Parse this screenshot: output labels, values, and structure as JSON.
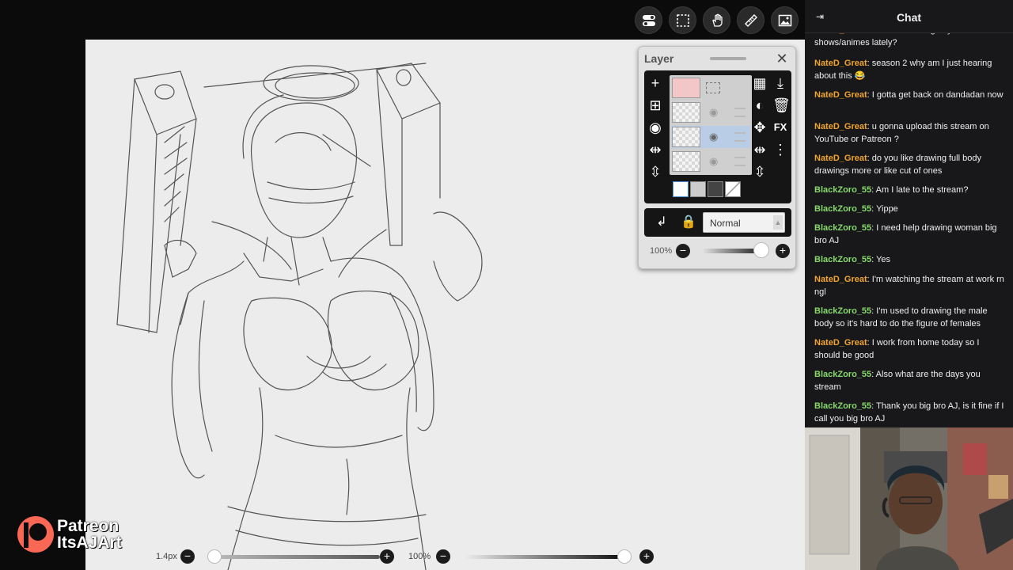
{
  "toolbar": {
    "icons": [
      "toggle-icon",
      "selection-icon",
      "hand-icon",
      "ruler-icon",
      "image-icon"
    ]
  },
  "layer_panel": {
    "title": "Layer",
    "close": "✕",
    "blend_mode": "Normal",
    "opacity_label": "100%"
  },
  "bottom_bar": {
    "brush_size": "1.4px",
    "brush_opacity": "100%"
  },
  "patreon": {
    "line1": "Patreon",
    "line2": "ItsAJArt"
  },
  "chat": {
    "title": "Chat",
    "messages": [
      {
        "user": "NateD_Great",
        "text": "u been watching any shows/animes lately?"
      },
      {
        "user": "NateD_Great",
        "text": "season 2 why am I just hearing about this 😂"
      },
      {
        "user": "NateD_Great",
        "text": "I gotta get back on dandadan now"
      },
      {
        "user": "NateD_Great",
        "text": "u gonna upload this stream on YouTube or Patreon ?"
      },
      {
        "user": "NateD_Great",
        "text": "do you like drawing full body drawings more or like cut of ones"
      },
      {
        "user": "BlackZoro_55",
        "text": "Am I late to the stream?"
      },
      {
        "user": "BlackZoro_55",
        "text": "Yippe"
      },
      {
        "user": "BlackZoro_55",
        "text": "I need help drawing woman big bro AJ"
      },
      {
        "user": "BlackZoro_55",
        "text": "Yes"
      },
      {
        "user": "NateD_Great",
        "text": "I'm watching the stream at work rn ngl"
      },
      {
        "user": "BlackZoro_55",
        "text": "I'm used to drawing the male body so it's hard to do the figure of females"
      },
      {
        "user": "NateD_Great",
        "text": "I work from home today so I should be good"
      },
      {
        "user": "BlackZoro_55",
        "text": "Also what are the days you stream"
      },
      {
        "user": "BlackZoro_55",
        "text": "Thank you big bro AJ, is it fine if I call you big bro AJ"
      }
    ]
  },
  "colors": {
    "nate": "#f0a431",
    "zoro": "#87d96c",
    "chat_bg": "#18181b",
    "paper": "#ececec"
  }
}
